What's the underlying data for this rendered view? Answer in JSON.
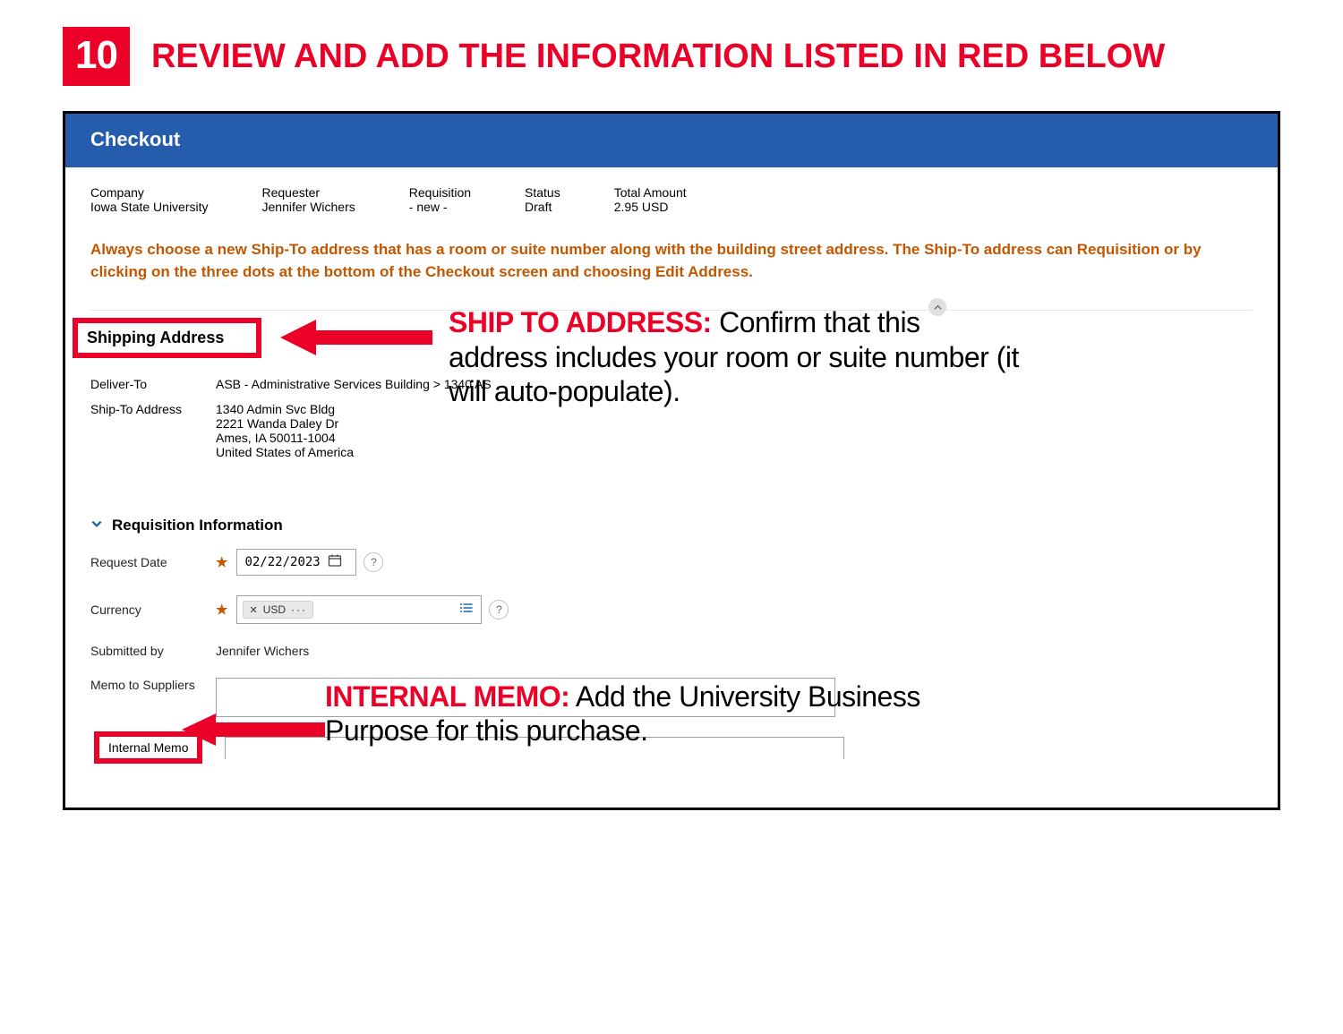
{
  "step": {
    "number": "10",
    "title": "REVIEW AND ADD THE INFORMATION LISTED IN RED BELOW"
  },
  "checkout": {
    "header": "Checkout",
    "meta": {
      "company_label": "Company",
      "company_value": "Iowa State University",
      "requester_label": "Requester",
      "requester_value": "Jennifer Wichers",
      "requisition_label": "Requisition",
      "requisition_value": "- new -",
      "status_label": "Status",
      "status_value": "Draft",
      "total_label": "Total Amount",
      "total_value": "2.95 USD"
    },
    "warning": "Always choose a new Ship-To address that has a room or suite number along with the building street address. The Ship-To address can Requisition or by clicking on the three dots at the bottom of the Checkout screen and choosing Edit Address.",
    "shipping": {
      "section_label": "Shipping Address",
      "deliver_label": "Deliver-To",
      "deliver_value": "ASB - Administrative Services Building > 1340 AS",
      "shipto_label": "Ship-To Address",
      "addr_line1": "1340 Admin Svc Bldg",
      "addr_line2": "2221 Wanda Daley Dr",
      "addr_line3": "Ames, IA 50011-1004",
      "addr_line4": "United States of America"
    },
    "callout1": {
      "lead": "SHIP TO ADDRESS:",
      "rest": " Confirm that this address includes your room or suite number (it will auto-populate)."
    },
    "reqinfo": {
      "section_label": "Requisition Information",
      "request_date_label": "Request Date",
      "request_date_value": "02/22/2023",
      "currency_label": "Currency",
      "currency_chip": "USD",
      "submitted_label": "Submitted by",
      "submitted_value": "Jennifer Wichers",
      "memo_suppliers_label": "Memo to Suppliers",
      "internal_memo_label": "Internal Memo"
    },
    "callout2": {
      "lead": "INTERNAL MEMO:",
      "rest": " Add the University Business Purpose for this purchase."
    }
  }
}
